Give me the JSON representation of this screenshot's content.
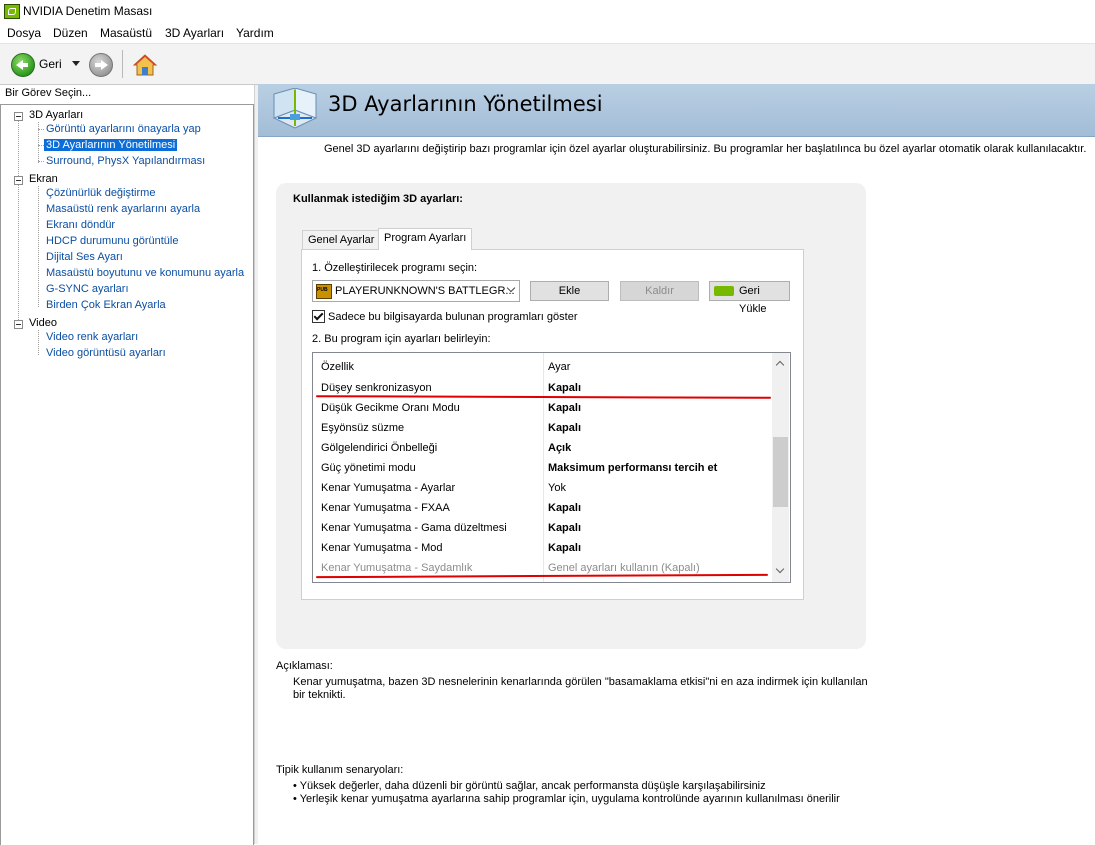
{
  "window": {
    "title": "NVIDIA Denetim Masası"
  },
  "menu": [
    "Dosya",
    "Düzen",
    "Masaüstü",
    "3D Ayarları",
    "Yardım"
  ],
  "toolbar": {
    "back_label": "Geri",
    "back_icon": "back-arrow-icon",
    "forward_icon": "forward-arrow-icon",
    "home_icon": "home-icon"
  },
  "sidebar": {
    "header": "Bir Görev Seçin...",
    "categories": [
      {
        "label": "3D Ayarları",
        "items": [
          "Görüntü ayarlarını önayarla yap",
          "3D Ayarlarının Yönetilmesi",
          "Surround, PhysX Yapılandırması"
        ]
      },
      {
        "label": "Ekran",
        "items": [
          "Çözünürlük değiştirme",
          "Masaüstü renk ayarlarını ayarla",
          "Ekranı döndür",
          "HDCP durumunu görüntüle",
          "Dijital Ses Ayarı",
          "Masaüstü boyutunu ve konumunu ayarla",
          "G-SYNC ayarları",
          "Birden Çok Ekran Ayarla"
        ]
      },
      {
        "label": "Video",
        "items": [
          "Video renk ayarları",
          "Video görüntüsü ayarları"
        ]
      }
    ],
    "selected": "3D Ayarlarının Yönetilmesi"
  },
  "main": {
    "title": "3D Ayarlarının Yönetilmesi",
    "description": "Genel 3D ayarlarını değiştirip bazı programlar için özel ayarlar oluşturabilirsiniz. Bu programlar her başlatılınca bu özel ayarlar otomatik olarak kullanılacaktır.",
    "panel_heading": "Kullanmak istediğim 3D ayarları:",
    "tabs": [
      {
        "label": "Genel Ayarlar",
        "active": false
      },
      {
        "label": "Program Ayarları",
        "active": true
      }
    ],
    "step1_label": "1. Özelleştirilecek programı seçin:",
    "program_select_value": "PLAYERUNKNOWN'S BATTLEGR...",
    "add_button": "Ekle",
    "remove_button": "Kaldır",
    "restore_button": "Geri Yükle",
    "show_only_installed_label": "Sadece bu bilgisayarda bulunan programları göster",
    "show_only_installed_checked": true,
    "step2_label": "2. Bu program için ayarları belirleyin:",
    "table": {
      "headers": {
        "feature": "Özellik",
        "value": "Ayar"
      },
      "rows": [
        {
          "feature": "Düşey senkronizasyon",
          "value": "Kapalı"
        },
        {
          "feature": "Düşük Gecikme Oranı Modu",
          "value": "Kapalı"
        },
        {
          "feature": "Eşyönsüz süzme",
          "value": "Kapalı"
        },
        {
          "feature": "Gölgelendirici Önbelleği",
          "value": "Açık"
        },
        {
          "feature": "Güç yönetimi modu",
          "value": "Maksimum performansı tercih et"
        },
        {
          "feature": "Kenar Yumuşatma - Ayarlar",
          "value": "Yok"
        },
        {
          "feature": "Kenar Yumuşatma - FXAA",
          "value": "Kapalı"
        },
        {
          "feature": "Kenar Yumuşatma - Gama düzeltmesi",
          "value": "Kapalı"
        },
        {
          "feature": "Kenar Yumuşatma - Mod",
          "value": "Kapalı"
        },
        {
          "feature": "Kenar Yumuşatma - Saydamlık",
          "value": "Genel ayarları kullanın (Kapalı)"
        }
      ]
    }
  },
  "description_section": {
    "label": "Açıklaması:",
    "text": "Kenar yumuşatma, bazen 3D nesnelerinin kenarlarında görülen \"basamaklama etkisi\"ni en aza indirmek için kullanılan bir teknikti."
  },
  "usage_section": {
    "label": "Tipik kullanım senaryoları:",
    "bullets": [
      "• Yüksek değerler, daha düzenli bir görüntü sağlar, ancak performansta düşüşle karşılaşabilirsiniz",
      "• Yerleşik kenar yumuşatma ayarlarına sahip programlar için, uygulama kontrolünde ayarının kullanılması önerilir"
    ]
  },
  "colors": {
    "accent": "#76b900",
    "header_bg": "#b9cfe3",
    "link": "#0b4fa3",
    "selection": "#0a6dd9",
    "annotation": "#e00000"
  }
}
